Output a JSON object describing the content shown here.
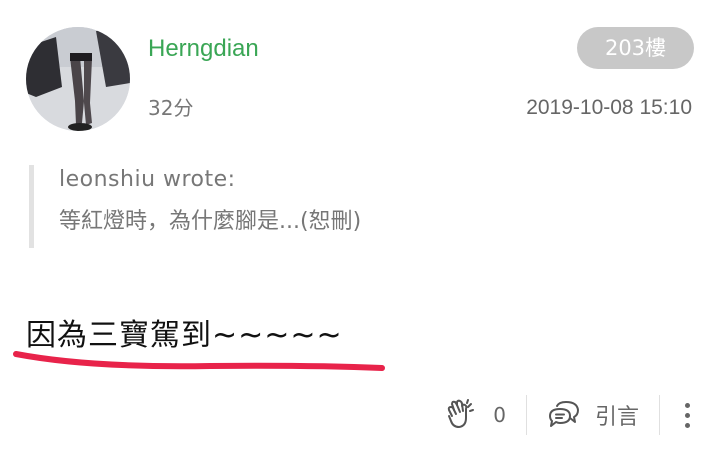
{
  "post": {
    "username": "Herngdian",
    "score": "32分",
    "floor": "203樓",
    "timestamp": "2019-10-08 15:10",
    "quote": {
      "author": "leonshiu wrote:",
      "text": "等紅燈時，為什麼腳是...(恕刪)"
    },
    "content": "因為三寶駕到~~~~~",
    "actions": {
      "like_count": "0",
      "quote_label": "引言"
    }
  },
  "colors": {
    "username": "#3aa655",
    "badge_bg": "#c8c8c8",
    "underline": "#e8234a",
    "muted_text": "#777777"
  },
  "icons": {
    "like": "clapping-hands-icon",
    "quote": "speech-bubbles-icon",
    "more": "vertical-dots-icon"
  }
}
